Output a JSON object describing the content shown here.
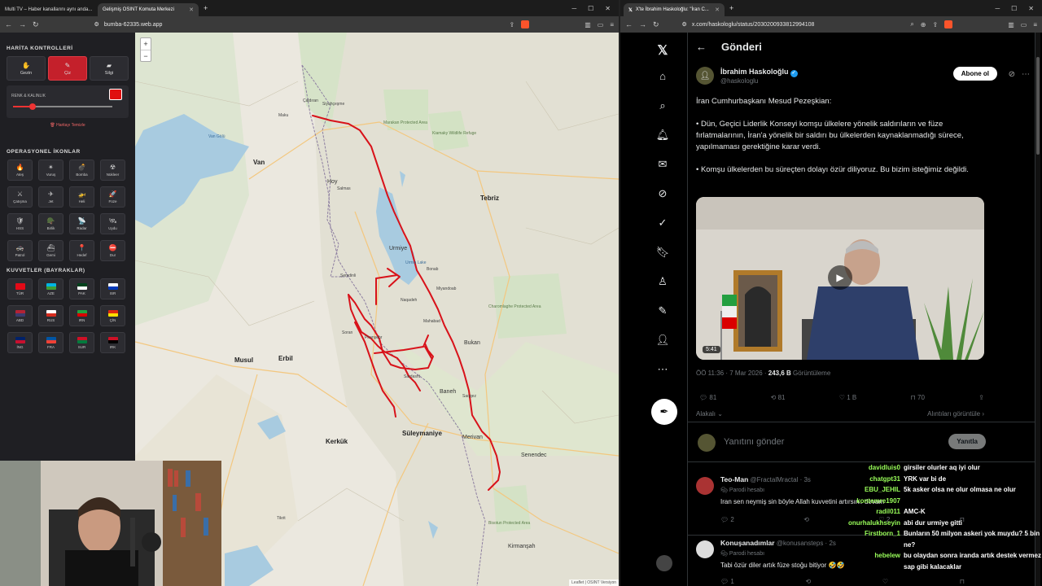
{
  "left_browser": {
    "tabs": [
      {
        "label": "Multi TV – Haber kanallarını aynı anda..."
      },
      {
        "label": "Gelişmiş OSINT Komuta Merkezi",
        "active": true
      }
    ],
    "url": "bumba-62335.web.app"
  },
  "panel": {
    "section_map_controls": "HARİTA KONTROLLERİ",
    "map_buttons": [
      "Gezin",
      "Çiz",
      "Silgi"
    ],
    "color_width_label": "RENK & KALINLIK",
    "draw_color": "#e01010",
    "stroke_width_level": 0.2,
    "clear_map": "Haritayı Temizle",
    "section_ops": "OPERASYONEL İKONLAR",
    "ops_icons": [
      {
        "label": "Ateş",
        "icon": "fire-icon",
        "glyph": "🔥"
      },
      {
        "label": "Vuruş",
        "icon": "target-icon",
        "glyph": "✴"
      },
      {
        "label": "Bomba",
        "icon": "bomb-icon",
        "glyph": "💣"
      },
      {
        "label": "Nükleer",
        "icon": "nuclear-icon",
        "glyph": "☢"
      },
      {
        "label": "Çatışma",
        "icon": "swords-icon",
        "glyph": "⚔"
      },
      {
        "label": "Jet",
        "icon": "jet-icon",
        "glyph": "✈"
      },
      {
        "label": "Heli",
        "icon": "helicopter-icon",
        "glyph": "🚁"
      },
      {
        "label": "Füze",
        "icon": "missile-icon",
        "glyph": "🚀"
      },
      {
        "label": "HSS",
        "icon": "shield-icon",
        "glyph": "🛡"
      },
      {
        "label": "Birlik",
        "icon": "troops-icon",
        "glyph": "🪖"
      },
      {
        "label": "Radar",
        "icon": "radar-icon",
        "glyph": "📡"
      },
      {
        "label": "Uydu",
        "icon": "satellite-icon",
        "glyph": "🛰"
      },
      {
        "label": "Patrol",
        "icon": "patrol-icon",
        "glyph": "🚓"
      },
      {
        "label": "Gemi",
        "icon": "ship-icon",
        "glyph": "⛴"
      },
      {
        "label": "Hedef",
        "icon": "pin-icon",
        "glyph": "📍"
      },
      {
        "label": "Dur",
        "icon": "stop-icon",
        "glyph": "⛔"
      }
    ],
    "section_forces": "KUVVETLER (BAYRAKLAR)",
    "flags": [
      {
        "label": "TÜR",
        "colors": [
          "#e30a17",
          "#e30a17"
        ]
      },
      {
        "label": "AZE",
        "colors": [
          "#00b5e2",
          "#3f9c35"
        ]
      },
      {
        "label": "PAK",
        "colors": [
          "#01411c",
          "#ffffff"
        ]
      },
      {
        "label": "ISR",
        "colors": [
          "#ffffff",
          "#0038b8"
        ]
      },
      {
        "label": "ABD",
        "colors": [
          "#b22234",
          "#3c3b6e"
        ]
      },
      {
        "label": "RUS",
        "colors": [
          "#ffffff",
          "#d52b1e"
        ]
      },
      {
        "label": "IRN",
        "colors": [
          "#239f40",
          "#da0000"
        ]
      },
      {
        "label": "ÇİN",
        "colors": [
          "#de2910",
          "#ffde00"
        ]
      },
      {
        "label": "İNG",
        "colors": [
          "#012169",
          "#c8102e"
        ]
      },
      {
        "label": "FRA",
        "colors": [
          "#0055a4",
          "#ef4135"
        ]
      },
      {
        "label": "SUR",
        "colors": [
          "#ce1126",
          "#007a3d"
        ]
      },
      {
        "label": "IRK",
        "colors": [
          "#ce1126",
          "#000000"
        ]
      }
    ]
  },
  "map": {
    "zoom_in": "+",
    "zoom_out": "−",
    "attribution": "Leaflet | OSINT Versiyon",
    "places": [
      {
        "name": "Siyahçeşme",
        "cls": "small"
      },
      {
        "name": "Maku",
        "cls": "small"
      },
      {
        "name": "Çaldıran",
        "cls": "small"
      },
      {
        "name": "Marakan Protected Area",
        "cls": "green"
      },
      {
        "name": "Kiamaky Wildlife Refuge",
        "cls": "green"
      },
      {
        "name": "Van",
        "cls": "big"
      },
      {
        "name": "Van Gölü",
        "cls": "blue"
      },
      {
        "name": "Hoy",
        "cls": ""
      },
      {
        "name": "Tebriz",
        "cls": "big"
      },
      {
        "name": "Salmas",
        "cls": "small"
      },
      {
        "name": "Urmiye",
        "cls": ""
      },
      {
        "name": "Urmia Lake",
        "cls": "blue"
      },
      {
        "name": "Şemdinli",
        "cls": "small"
      },
      {
        "name": "Bonab",
        "cls": "small"
      },
      {
        "name": "Miyandoab",
        "cls": "small"
      },
      {
        "name": "Naqadeh",
        "cls": "small"
      },
      {
        "name": "Mahabad",
        "cls": "small"
      },
      {
        "name": "Bukan",
        "cls": ""
      },
      {
        "name": "Charomlaghe Protected Area",
        "cls": "green"
      },
      {
        "name": "Soran",
        "cls": "small"
      },
      {
        "name": "Piranşehr",
        "cls": "small"
      },
      {
        "name": "Musul",
        "cls": "big"
      },
      {
        "name": "Erbil",
        "cls": "big"
      },
      {
        "name": "Sardasht",
        "cls": "small"
      },
      {
        "name": "Baneh",
        "cls": ""
      },
      {
        "name": "Saqqez",
        "cls": "small"
      },
      {
        "name": "Süleymaniye",
        "cls": "big"
      },
      {
        "name": "Kerkük",
        "cls": "big"
      },
      {
        "name": "Merivan",
        "cls": ""
      },
      {
        "name": "Senendec",
        "cls": ""
      },
      {
        "name": "Tikrit",
        "cls": "small"
      },
      {
        "name": "Kirmanşah",
        "cls": ""
      },
      {
        "name": "Bisotun Protected Area",
        "cls": "green"
      }
    ]
  },
  "right_browser": {
    "tab": "X'te İbrahim Haskoloğlu: \"İran C...",
    "url": "x.com/haskologlu/status/2030200933812994108"
  },
  "x": {
    "header": "Gönderi",
    "author_name": "İbrahim Haskoloğlu",
    "author_handle": "@haskologlu",
    "subscribe": "Abone ol",
    "paragraphs": [
      "İran Cumhurbaşkanı Mesud Pezeşkian:",
      "• Dün, Geçici Liderlik Konseyi komşu ülkelere yönelik saldırıların ve füze fırlatmalarının, İran'a yönelik bir saldırı bu ülkelerden kaynaklanmadığı sürece, yapılmaması gerektiğine karar verdi.",
      "• Komşu ülkelerden bu süreçten dolayı özür diliyoruz. Bu bizim isteğimiz değildi."
    ],
    "video_duration": "5:41",
    "time": "ÖÖ 11:36 · 7 Mar 2026 · ",
    "views": "243,6 B",
    "views_suffix": " Görüntüleme",
    "stats": {
      "replies": "81",
      "reposts": "81",
      "likes": "1 B",
      "bookmarks": "70"
    },
    "sort_label": "Alakalı",
    "quotes_label": "Alıntıları görüntüle",
    "reply_placeholder": "Yanıtını gönder",
    "reply_button": "Yanıtla",
    "comments": [
      {
        "name": "Teo-Man",
        "handle": "@FractalMractal · 3s",
        "badge": "Parodi hesabı",
        "text": "Iran sen neymiş sin böyle Allah kuvvetini artırsın.. devam",
        "replies": "2",
        "likes": "2"
      },
      {
        "name": "Konuşanadımlar",
        "handle": "@konusansteps · 2s",
        "badge": "Parodi hesabı",
        "text": "Tabi özür diler artık füze stoğu bitiyor 🤣🤣",
        "replies": "1",
        "likes": ""
      }
    ]
  },
  "chat": [
    {
      "user": "davidluis0",
      "msg": "girsiler olurler aq iyi olur"
    },
    {
      "user": "chatgpt31",
      "msg": "YRK var bi de"
    },
    {
      "user": "EBU_JEHIL",
      "msg": "5k asker olsa ne olur olmasa ne olur"
    },
    {
      "user": "kontemre1907",
      "msg": ""
    },
    {
      "user": "radil011",
      "msg": "AMC-K"
    },
    {
      "user": "onurhalukhseyin",
      "msg": "abi dur urmiye gitti"
    },
    {
      "user": "Firstborn_1",
      "msg": "Bunların 50 milyon askeri yok muydu? 5 bin ne?"
    },
    {
      "user": "hebelew",
      "msg": "bu olaydan sonra iranda artık destek vermez sap gibi kalacaklar"
    }
  ]
}
